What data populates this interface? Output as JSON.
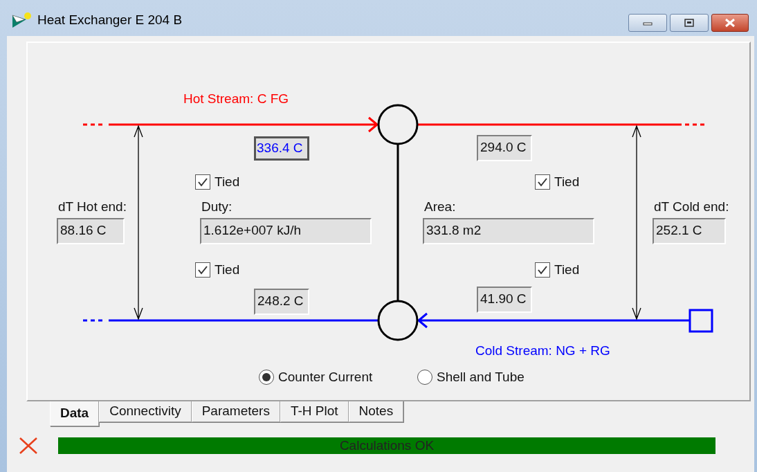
{
  "window": {
    "title": "Heat Exchanger E 204 B"
  },
  "diagram": {
    "hot_stream": {
      "label": "Hot Stream: C FG"
    },
    "cold_stream": {
      "label": "Cold Stream: NG + RG"
    },
    "temperatures": [
      {
        "value": "336.4 C",
        "focused": true
      },
      {
        "value": "294.0 C",
        "focused": false
      },
      {
        "value": "248.2 C",
        "focused": false
      },
      {
        "value": "41.90 C",
        "focused": false
      }
    ],
    "tied": [
      {
        "label": "Tied",
        "checked": true
      },
      {
        "label": "Tied",
        "checked": true
      },
      {
        "label": "Tied",
        "checked": true
      },
      {
        "label": "Tied",
        "checked": true
      }
    ],
    "results": [
      {
        "label": "dT Hot end:",
        "value": "88.16 C"
      },
      {
        "label": "Duty:",
        "value": "1.612e+007 kJ/h"
      },
      {
        "label": "Area:",
        "value": "331.8 m2"
      },
      {
        "label": "dT Cold end:",
        "value": "252.1 C"
      }
    ],
    "flow_options": [
      {
        "label": "Counter Current",
        "selected": true
      },
      {
        "label": "Shell and Tube",
        "selected": false
      }
    ]
  },
  "tabs": [
    {
      "label": "Data",
      "selected": true
    },
    {
      "label": "Connectivity",
      "selected": false
    },
    {
      "label": "Parameters",
      "selected": false
    },
    {
      "label": "T-H Plot",
      "selected": false
    },
    {
      "label": "Notes",
      "selected": false
    }
  ],
  "status": {
    "message": "Calculations OK",
    "ok": true
  }
}
